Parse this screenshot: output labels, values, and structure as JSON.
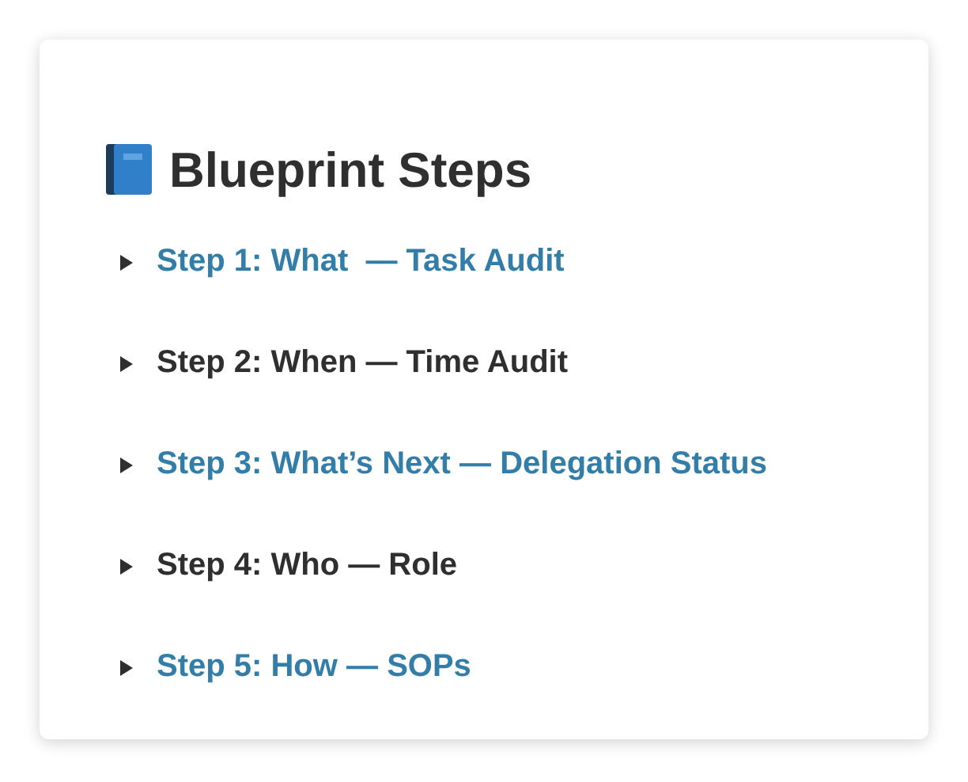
{
  "title": "Blueprint Steps",
  "steps": [
    {
      "label": "Step 1: What  — Task Audit",
      "kind": "link",
      "expanded": false
    },
    {
      "label": "Step 2: When — Time Audit",
      "kind": "text",
      "expanded": false
    },
    {
      "label": "Step 3: What’s Next — Delegation Status",
      "kind": "link",
      "expanded": false
    },
    {
      "label": "Step 4: Who — Role",
      "kind": "text",
      "expanded": false
    },
    {
      "label": "Step 5: How — SOPs",
      "kind": "link",
      "expanded": false
    }
  ]
}
